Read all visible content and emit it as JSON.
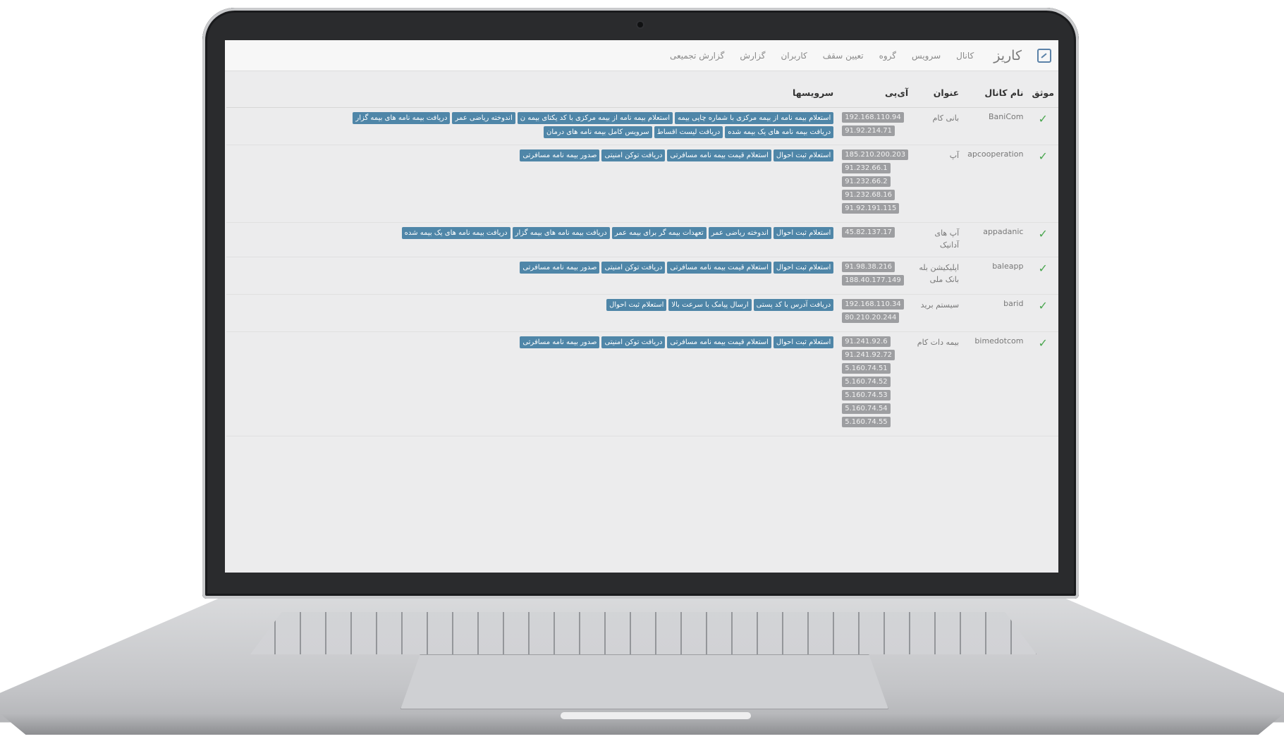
{
  "app": {
    "brand": "کاریز",
    "logo_icon": "edit-square-icon"
  },
  "nav": [
    {
      "label": "کانال"
    },
    {
      "label": "سرویس"
    },
    {
      "label": "گروه"
    },
    {
      "label": "تعیین سقف"
    },
    {
      "label": "کاربران"
    },
    {
      "label": "گزارش"
    },
    {
      "label": "گزارش تجمیعی"
    }
  ],
  "table": {
    "headers": {
      "trusted": "موثق",
      "channel_name": "نام کانال",
      "title": "عنوان",
      "ip": "آی‌پی",
      "services": "سرویسها"
    },
    "rows": [
      {
        "trusted_icon": "check-icon",
        "channel_name": "BaniCom",
        "title": "بانی کام",
        "ips": [
          "192.168.110.94",
          "91.92.214.71"
        ],
        "services": [
          "استعلام بیمه نامه از بیمه مرکزی با شماره چاپی بیمه",
          "استعلام بیمه نامه از بیمه مرکزی با کد یکتای بیمه ن",
          "اندوخته ریاضی عمر",
          "دریافت بیمه نامه های بیمه گزار",
          "دریافت بیمه نامه های یک بیمه شده",
          "دریافت لیست اقساط",
          "سرویس کامل بیمه نامه های درمان"
        ]
      },
      {
        "trusted_icon": "check-icon",
        "channel_name": "apcooperation",
        "title": "آپ",
        "ips": [
          "185.210.200.203",
          "91.232.66.1",
          "91.232.66.2",
          "91.232.68.16",
          "91.92.191.115"
        ],
        "services": [
          "استعلام ثبت احوال",
          "استعلام قیمت بیمه نامه مسافرتی",
          "دریافت توکن امنیتی",
          "صدور بیمه نامه مسافرتی"
        ]
      },
      {
        "trusted_icon": "check-icon",
        "channel_name": "appadanic",
        "title": "آپ های آدانیک",
        "ips": [
          "45.82.137.17"
        ],
        "services": [
          "استعلام ثبت احوال",
          "اندوخته ریاضی عمر",
          "تعهدات بیمه گر برای بیمه عمر",
          "دریافت بیمه نامه های بیمه گزار",
          "دریافت بیمه نامه های یک بیمه شده"
        ]
      },
      {
        "trusted_icon": "check-icon",
        "channel_name": "baleapp",
        "title": "اپلیکیشن بله بانک ملی",
        "ips": [
          "91.98.38.216",
          "188.40.177.149"
        ],
        "services": [
          "استعلام ثبت احوال",
          "استعلام قیمت بیمه نامه مسافرتی",
          "دریافت توکن امنیتی",
          "صدور بیمه نامه مسافرتی"
        ]
      },
      {
        "trusted_icon": "check-icon",
        "channel_name": "barid",
        "title": "سیستم برید",
        "ips": [
          "192.168.110.34",
          "80.210.20.244"
        ],
        "services": [
          "دریافت آدرس با کد پستی",
          "ارسال پیامک با سرعت بالا",
          "استعلام ثبت احوال"
        ]
      },
      {
        "trusted_icon": "check-icon",
        "channel_name": "bimedotcom",
        "title": "بیمه دات کام",
        "ips": [
          "91.241.92.6",
          "91.241.92.72",
          "5.160.74.51",
          "5.160.74.52",
          "5.160.74.53",
          "5.160.74.54",
          "5.160.74.55"
        ],
        "services": [
          "استعلام ثبت احوال",
          "استعلام قیمت بیمه نامه مسافرتی",
          "دریافت توکن امنیتی",
          "صدور بیمه نامه مسافرتی"
        ]
      }
    ]
  }
}
